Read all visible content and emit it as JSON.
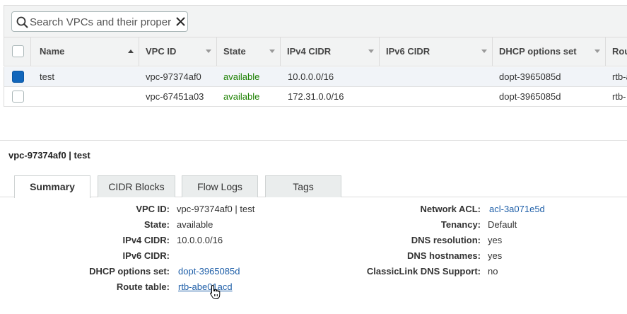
{
  "search": {
    "placeholder": "Search VPCs and their proper",
    "value": ""
  },
  "table": {
    "columns": [
      "Name",
      "VPC ID",
      "State",
      "IPv4 CIDR",
      "IPv6 CIDR",
      "DHCP options set",
      "Rou"
    ],
    "rows": [
      {
        "selected": true,
        "name": "test",
        "vpc_id": "vpc-97374af0",
        "state": "available",
        "ipv4": "10.0.0.0/16",
        "ipv6": "",
        "dhcp": "dopt-3965085d",
        "route": "rtb-a"
      },
      {
        "selected": false,
        "name": "",
        "vpc_id": "vpc-67451a03",
        "state": "available",
        "ipv4": "172.31.0.0/16",
        "ipv6": "",
        "dhcp": "dopt-3965085d",
        "route": "rtb-"
      }
    ]
  },
  "detail": {
    "title": "vpc-97374af0 | test",
    "tabs": [
      "Summary",
      "CIDR Blocks",
      "Flow Logs",
      "Tags"
    ],
    "left": [
      {
        "label": "VPC ID:",
        "value": "vpc-97374af0 | test"
      },
      {
        "label": "State:",
        "value": "available"
      },
      {
        "label": "IPv4 CIDR:",
        "value": "10.0.0.0/16"
      },
      {
        "label": "IPv6 CIDR:",
        "value": ""
      },
      {
        "label": "DHCP options set:",
        "value": "dopt-3965085d"
      },
      {
        "label": "Route table:",
        "value": "rtb-abe01acd"
      }
    ],
    "right": [
      {
        "label": "Network ACL:",
        "value": "acl-3a071e5d"
      },
      {
        "label": "Tenancy:",
        "value": "Default"
      },
      {
        "label": "DNS resolution:",
        "value": "yes"
      },
      {
        "label": "DNS hostnames:",
        "value": "yes"
      },
      {
        "label": "ClassicLink DNS Support:",
        "value": "no"
      }
    ]
  },
  "colors": {
    "state_green": "#1d8102",
    "link_blue": "#1f5fa8",
    "selected_checkbox": "#1166bb"
  },
  "icons": [
    "search-icon",
    "clear-icon",
    "sort-asc-icon",
    "sort-desc-icon",
    "hand-pointer-icon"
  ]
}
